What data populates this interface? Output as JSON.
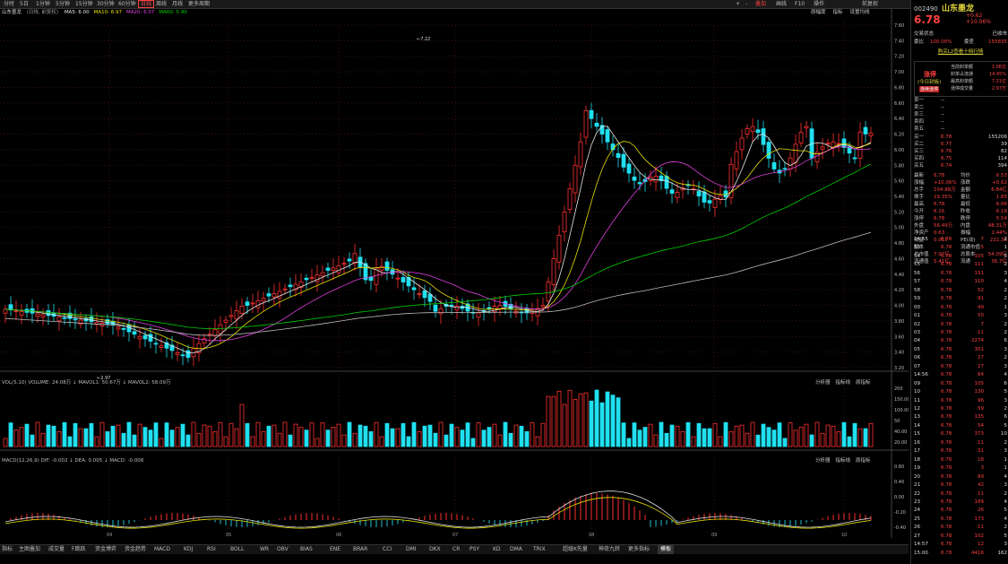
{
  "toolbar": {
    "periods": [
      "分时",
      "5日",
      "1分钟",
      "5分钟",
      "15分钟",
      "30分钟",
      "60分钟",
      "日线",
      "周线",
      "月线",
      "更多周期"
    ],
    "active_period": "日线",
    "right_items": [
      "+",
      "-",
      "叠加",
      "画线",
      "F10",
      "操作",
      "前复权"
    ],
    "tab_highlight": "复权"
  },
  "chart": {
    "stock_label": "山东墨龙",
    "sub_label": "(日线, 前复权)",
    "ma_labels": [
      {
        "text": "MA5: 6.00",
        "color": "#e8e8e8"
      },
      {
        "text": "MA10: 6.97",
        "color": "#e8e000"
      },
      {
        "text": "MA20: 6.07",
        "color": "#e040e0"
      },
      {
        "text": "MA60: 5.90",
        "color": "#00d000"
      }
    ],
    "right_btns": [
      "原幅度",
      "指标",
      "设置均线"
    ],
    "price_axis": [
      "7.60",
      "7.40",
      "7.20",
      "7.00",
      "6.80",
      "6.60",
      "6.40",
      "6.20",
      "6.00",
      "5.80",
      "5.60",
      "5.40",
      "5.20",
      "5.00",
      "4.80",
      "4.60",
      "4.40",
      "4.20",
      "4.00",
      "3.80",
      "3.60",
      "3.40",
      "3.20"
    ],
    "high_note": "7.22",
    "low_note": "2.97",
    "vol_header": "VOL(5,10)  VOLUME: 24.08万  ↓ MAVOL1: 50.67万  ↓ MAVOL2: 58.09万",
    "vol_axis": [
      "200",
      "150.00",
      "100.00",
      "50",
      "40.00",
      "20.00"
    ],
    "vol_btns": [
      "分析器",
      "指标线",
      "原指标"
    ],
    "macd_header": "MACD(12,26,9)  DIF: -0.002  ↓ DEA: 0.005  ↓ MACD: -0.008",
    "macd_axis": [
      "0.80",
      "0.40",
      "0.00",
      "-0.20",
      "-0.40"
    ],
    "x_labels": [
      "04",
      "05",
      "06",
      "07",
      "08",
      "09",
      "10"
    ]
  },
  "bottom_tabs": [
    "指标",
    "主图叠加",
    "成交量",
    "F跳跃",
    "资金博弈",
    "资金趋势",
    "MACD",
    "KDJ",
    "RSI",
    "BOLL",
    "WR",
    "OBV",
    "BIAS",
    "ENE",
    "BRAR",
    "CCI",
    "DMI",
    "DKX",
    "CR",
    "PSY",
    "KD",
    "DMA",
    "TRIX",
    "超级K先量",
    "神奇九转",
    "更多指标",
    "模板"
  ],
  "quote": {
    "code": "002490",
    "name": "山东墨龙",
    "price": "6.78",
    "change": "+0.62",
    "change_pct": "+10.06%",
    "trade_status_label": "交易状态",
    "trade_status": "已收市",
    "weibi_label": "委比",
    "weibi": "100.00%",
    "weicha_label": "委差",
    "weicha": "155835",
    "l2_link": "购买L2查看十档行情",
    "limit_box": {
      "title": "涨停",
      "sub": "(今日封板)",
      "tag": "连续涨停",
      "lines": [
        {
          "k": "当前封单额",
          "v": "1.06亿"
        },
        {
          "k": "封单占流通",
          "v": "14.45%"
        },
        {
          "k": "最高封单额",
          "v": "7.21亿"
        },
        {
          "k": "涨停成交量",
          "v": "2.97万"
        }
      ]
    },
    "sell": [
      {
        "k": "卖五",
        "p": "--",
        "v": ""
      },
      {
        "k": "卖四",
        "p": "--",
        "v": ""
      },
      {
        "k": "卖三",
        "p": "--",
        "v": ""
      },
      {
        "k": "卖二",
        "p": "--",
        "v": ""
      },
      {
        "k": "卖一",
        "p": "--",
        "v": ""
      }
    ],
    "buy": [
      {
        "k": "买一",
        "p": "6.78",
        "v": "155206"
      },
      {
        "k": "买二",
        "p": "6.77",
        "v": "39"
      },
      {
        "k": "买三",
        "p": "6.76",
        "v": "82"
      },
      {
        "k": "买四",
        "p": "6.75",
        "v": "114"
      },
      {
        "k": "买五",
        "p": "6.74",
        "v": "394"
      }
    ],
    "stats": [
      {
        "k1": "最新",
        "v1": "6.78",
        "k2": "均价",
        "v2": "6.53"
      },
      {
        "k1": "涨幅",
        "v1": "+10.06%",
        "k2": "涨跌",
        "v2": "+0.62"
      },
      {
        "k1": "总手",
        "v1": "104.88万",
        "k2": "金额",
        "v2": "6.84亿"
      },
      {
        "k1": "换手",
        "v1": "19.35%",
        "k2": "量比",
        "v2": "1.65"
      },
      {
        "k1": "最高",
        "v1": "6.78",
        "k2": "最低",
        "v2": "6.06"
      },
      {
        "k1": "今开",
        "v1": "6.16",
        "k2": "昨收",
        "v2": "6.16"
      },
      {
        "k1": "涨停",
        "v1": "6.78",
        "k2": "跌停",
        "v2": "5.54"
      },
      {
        "k1": "外盘",
        "v1": "56.49万",
        "k2": "内盘",
        "v2": "48.31万"
      },
      {
        "k1": "净资产",
        "v1": "0.63",
        "k2": "振幅",
        "v2": "2.44%"
      },
      {
        "k1": "收益",
        "v1": "0.015",
        "k2": "PE(动)",
        "v2": "222.36"
      },
      {
        "k1": "股本",
        "v1": "",
        "k2": "流通市值",
        "v2": ""
      },
      {
        "k1": "总市值",
        "v1": "7.97亿",
        "k2": "总股本",
        "v2": "54.09亿"
      },
      {
        "k1": "流通值",
        "v1": "5.41亿",
        "k2": "流通",
        "v2": "36.7亿"
      }
    ],
    "ticks": [
      {
        "t": "14:55",
        "p": "6.78",
        "v": "7",
        "d": "2"
      },
      {
        "t": "53",
        "p": "6.78",
        "v": "5",
        "d": "1"
      },
      {
        "t": "54",
        "p": "6.78",
        "v": "105",
        "d": "5"
      },
      {
        "t": "55",
        "p": "6.78",
        "v": "111",
        "d": "2"
      },
      {
        "t": "56",
        "p": "6.78",
        "v": "151",
        "d": "3"
      },
      {
        "t": "57",
        "p": "6.78",
        "v": "110",
        "d": "4"
      },
      {
        "t": "58",
        "p": "6.78",
        "v": "52",
        "d": "2"
      },
      {
        "t": "59",
        "p": "6.78",
        "v": "91",
        "d": "2"
      },
      {
        "t": "00",
        "p": "6.78",
        "v": "49",
        "d": "1"
      },
      {
        "t": "01",
        "p": "6.78",
        "v": "50",
        "d": "3"
      },
      {
        "t": "02",
        "p": "6.78",
        "v": "7",
        "d": "2"
      },
      {
        "t": "03",
        "p": "6.78",
        "v": "11",
        "d": "2"
      },
      {
        "t": "04",
        "p": "6.78",
        "v": "2274",
        "d": "6"
      },
      {
        "t": "05",
        "p": "6.78",
        "v": "301",
        "d": "3"
      },
      {
        "t": "06",
        "p": "6.78",
        "v": "27",
        "d": "2"
      },
      {
        "t": "07",
        "p": "6.78",
        "v": "27",
        "d": "3"
      },
      {
        "t": "14:56",
        "p": "6.78",
        "v": "64",
        "d": "4"
      },
      {
        "t": "09",
        "p": "6.78",
        "v": "105",
        "d": "6"
      },
      {
        "t": "10",
        "p": "6.78",
        "v": "130",
        "d": "5"
      },
      {
        "t": "11",
        "p": "6.78",
        "v": "96",
        "d": "3"
      },
      {
        "t": "12",
        "p": "6.78",
        "v": "59",
        "d": "2"
      },
      {
        "t": "13",
        "p": "6.78",
        "v": "135",
        "d": "6"
      },
      {
        "t": "14",
        "p": "6.78",
        "v": "54",
        "d": "5"
      },
      {
        "t": "15",
        "p": "6.78",
        "v": "373",
        "d": "10"
      },
      {
        "t": "16",
        "p": "6.78",
        "v": "11",
        "d": "2"
      },
      {
        "t": "17",
        "p": "6.78",
        "v": "31",
        "d": "3"
      },
      {
        "t": "18",
        "p": "6.78",
        "v": "18",
        "d": "1"
      },
      {
        "t": "19",
        "p": "6.78",
        "v": "3",
        "d": "1"
      },
      {
        "t": "20",
        "p": "6.78",
        "v": "89",
        "d": "4"
      },
      {
        "t": "21",
        "p": "6.78",
        "v": "42",
        "d": "3"
      },
      {
        "t": "22",
        "p": "6.78",
        "v": "11",
        "d": "2"
      },
      {
        "t": "23",
        "p": "6.78",
        "v": "189",
        "d": "4"
      },
      {
        "t": "24",
        "p": "6.78",
        "v": "26",
        "d": "5"
      },
      {
        "t": "25",
        "p": "6.78",
        "v": "173",
        "d": "4"
      },
      {
        "t": "26",
        "p": "6.78",
        "v": "11",
        "d": "2"
      },
      {
        "t": "27",
        "p": "6.78",
        "v": "102",
        "d": "5"
      },
      {
        "t": "14:57",
        "p": "6.78",
        "v": "12",
        "d": "3"
      },
      {
        "t": "15:00",
        "p": "6.78",
        "v": "4416",
        "d": "162"
      }
    ]
  }
}
